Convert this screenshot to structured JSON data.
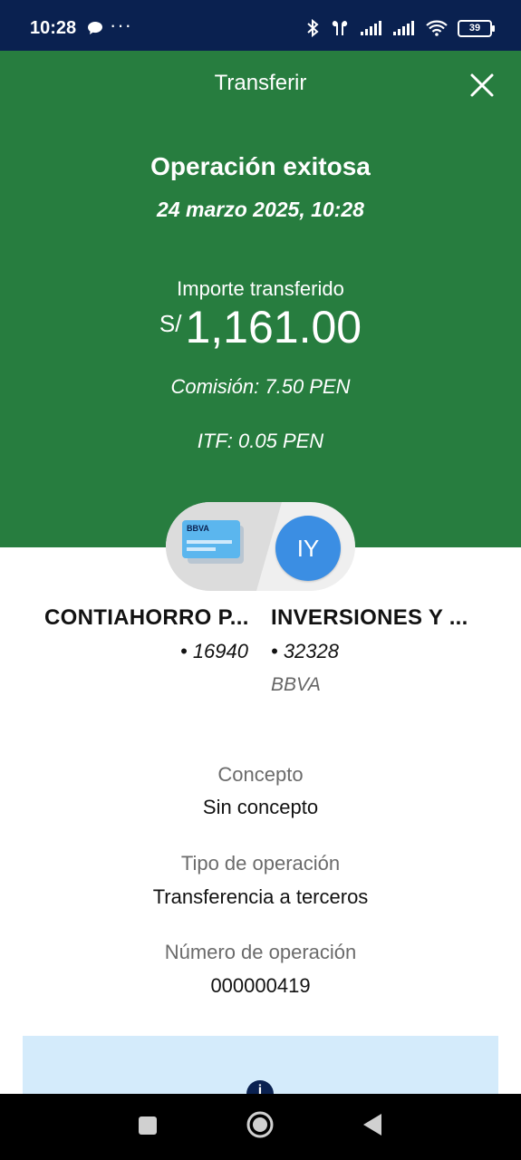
{
  "status_bar": {
    "time": "10:28",
    "more": "···",
    "battery": "39",
    "icons": [
      "chat-bubble-icon",
      "bluetooth-icon",
      "earbuds-icon",
      "signal-icon",
      "signal-icon",
      "wifi-icon",
      "battery-icon"
    ]
  },
  "header": {
    "title": "Transferir",
    "status": "Operación exitosa",
    "datetime": "24 marzo 2025, 10:28",
    "amount_label": "Importe transferido",
    "currency_symbol": "S/",
    "amount": "1,161.00",
    "commission": "Comisión: 7.50 PEN",
    "itf": "ITF: 0.05 PEN",
    "background_color": "#277d3f"
  },
  "transfer": {
    "card_brand": "BBVA",
    "recipient_initials": "IY",
    "origin": {
      "name": "CONTIAHORRO P...",
      "number": "• 16940"
    },
    "destination": {
      "name": "INVERSIONES Y ...",
      "number": "• 32328",
      "bank": "BBVA"
    }
  },
  "details": [
    {
      "label": "Concepto",
      "value": "Sin concepto"
    },
    {
      "label": "Tipo de operación",
      "value": "Transferencia a terceros"
    },
    {
      "label": "Número de operación",
      "value": "000000419"
    }
  ],
  "info_box": {
    "icon": "info-icon",
    "color": "#d4ebfb"
  },
  "nav_bar": {
    "icons": [
      "recent-apps-icon",
      "home-icon",
      "back-icon"
    ]
  }
}
